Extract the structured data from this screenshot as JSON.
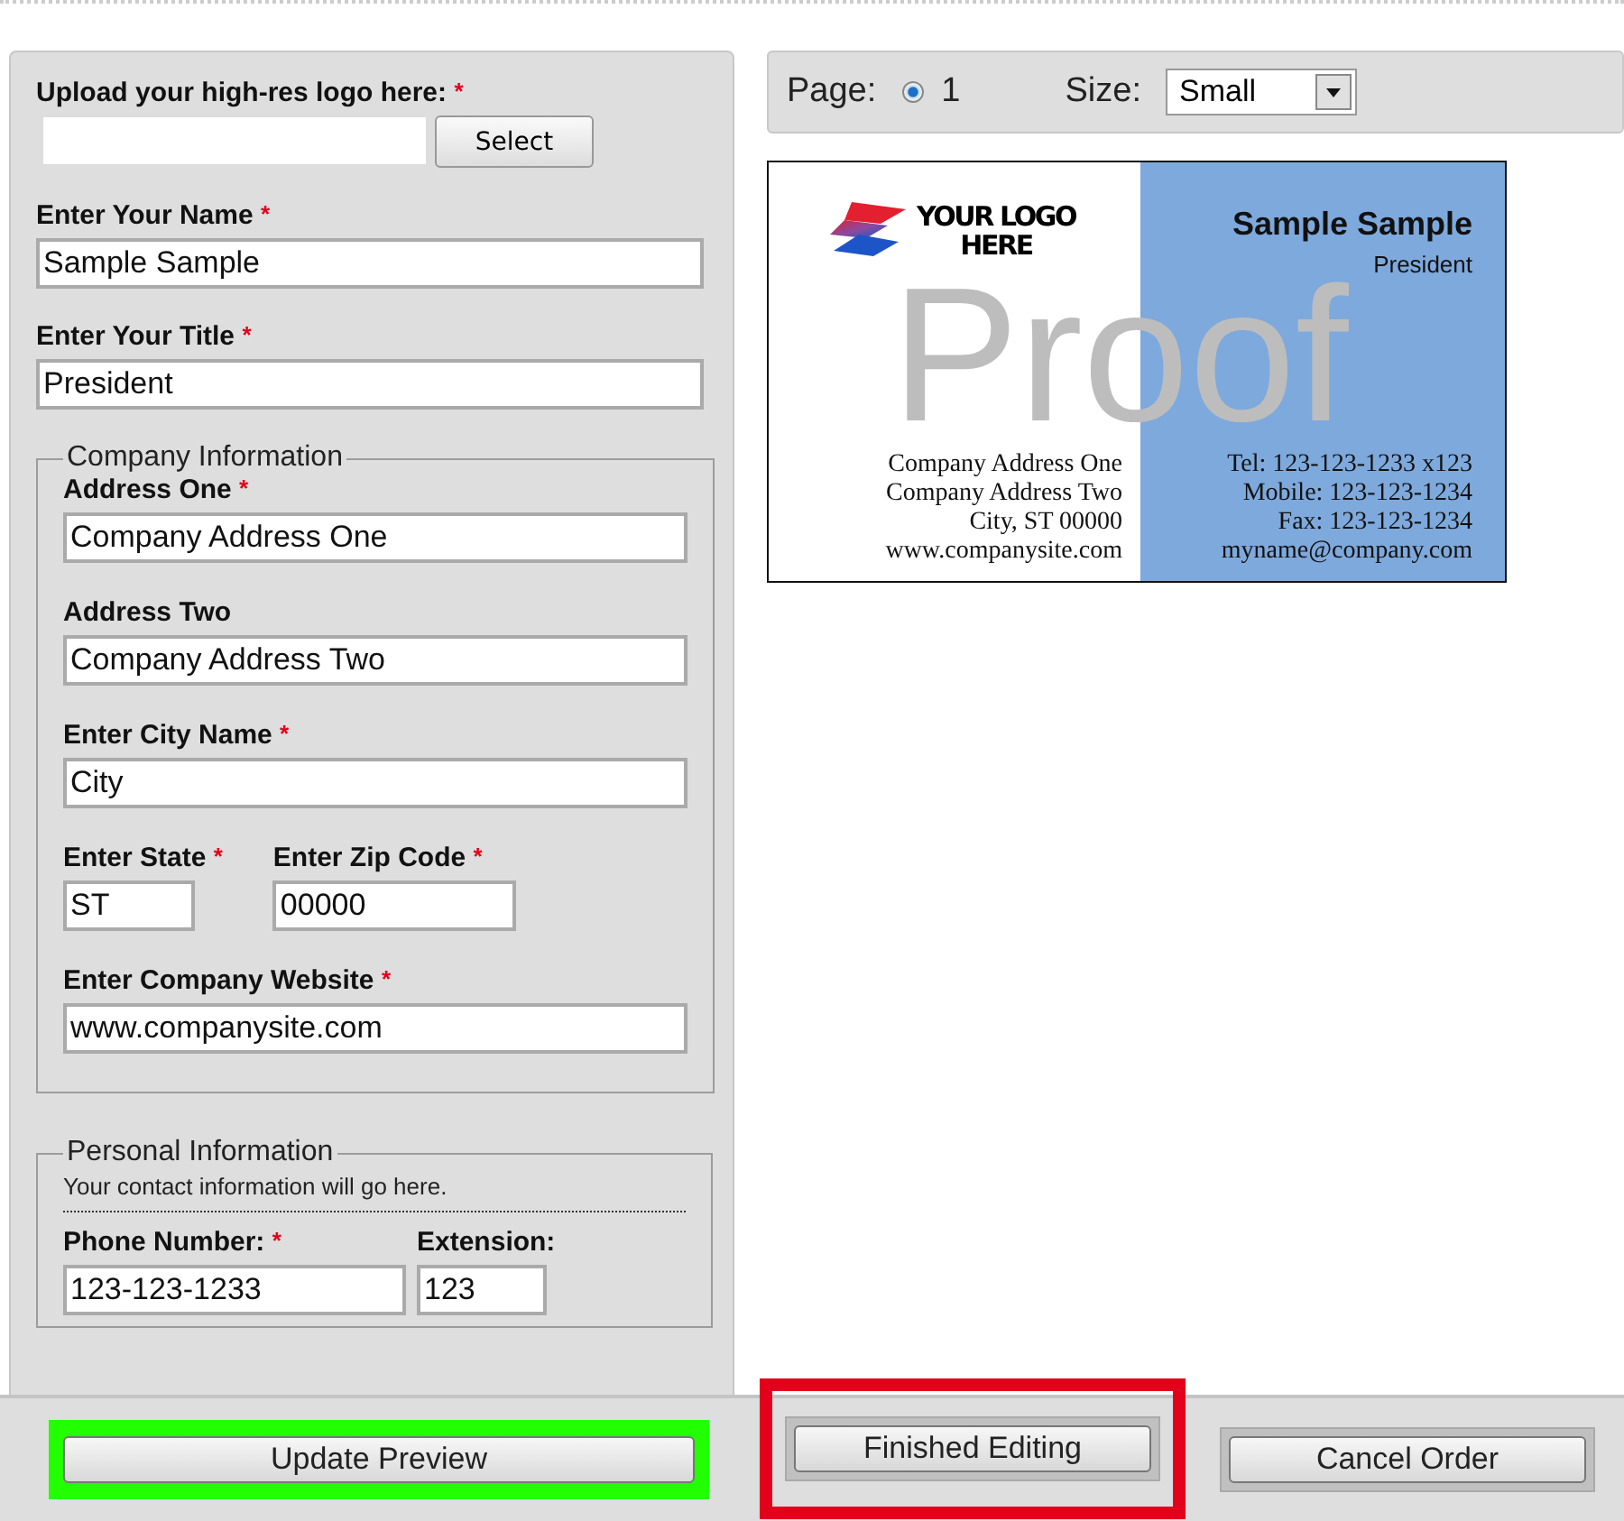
{
  "upload": {
    "label": "Upload your high-res logo here:",
    "required_mark": "*",
    "button": "Select"
  },
  "fields": [
    {
      "label": "Enter Your Name",
      "required_mark": "*",
      "value": "Sample Sample"
    },
    {
      "label": "Enter Your Title",
      "required_mark": "*",
      "value": "President"
    }
  ],
  "company": {
    "legend": "Company Information",
    "rows": [
      {
        "fields": [
          {
            "label": "Address One",
            "required_mark": "*",
            "value": "Company Address One"
          }
        ]
      },
      {
        "fields": [
          {
            "label": "Address Two",
            "value": "Company Address Two"
          }
        ]
      },
      {
        "fields": [
          {
            "label": "Enter City Name",
            "required_mark": "*",
            "value": "City"
          }
        ]
      },
      {
        "fields": [
          {
            "label": "Enter State",
            "required_mark": "*",
            "value": "ST"
          },
          {
            "label": "Enter Zip Code",
            "required_mark": "*",
            "value": "00000"
          }
        ]
      },
      {
        "fields": [
          {
            "label": "Enter Company Website",
            "required_mark": "*",
            "value": "www.companysite.com"
          }
        ]
      }
    ]
  },
  "personal": {
    "legend": "Personal Information",
    "note": "Your contact information will go here.",
    "rows": [
      {
        "fields": [
          {
            "label": "Phone Number:",
            "required_mark": "*",
            "value": "123-123-1233"
          },
          {
            "label": "Extension:",
            "value": "123"
          }
        ]
      }
    ]
  },
  "toolbar": {
    "page_label": "Page:",
    "page_selected": true,
    "page": "1",
    "size_label": "Size:",
    "size": "Small"
  },
  "card": {
    "logo": [
      "YOUR LOGO",
      "HERE"
    ],
    "name": "Sample Sample",
    "title": "President",
    "watermark": "Proof",
    "address": [
      "Company Address One",
      "Company Address Two",
      "City, ST 00000",
      "www.companysite.com"
    ],
    "contact": [
      "Tel: 123-123-1233 x123",
      "Mobile: 123-123-1234",
      "Fax: 123-123-1234",
      "myname@company.com"
    ]
  },
  "footer": [
    {
      "label": "Update Preview",
      "color": "#22ff00"
    },
    {
      "label": "Finished Editing",
      "color": "#e2001a"
    },
    {
      "label": "Cancel Order"
    }
  ]
}
